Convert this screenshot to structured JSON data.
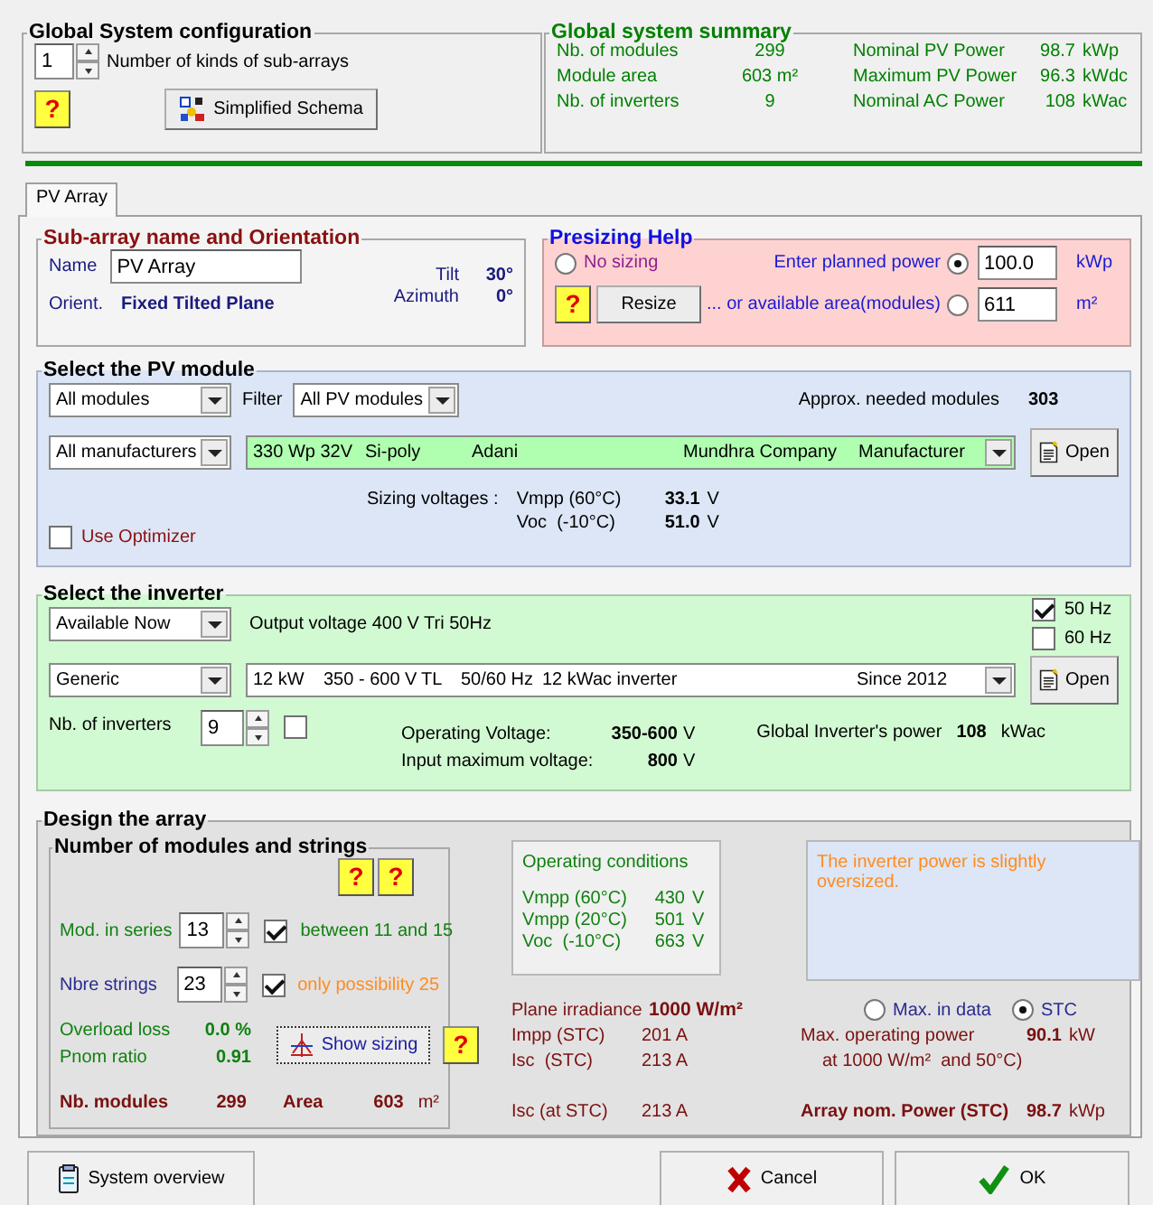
{
  "config": {
    "title": "Global System configuration",
    "kinds_value": "1",
    "kinds_label": "Number of kinds of sub-arrays",
    "help": "?",
    "schema_button": "Simplified Schema"
  },
  "summary": {
    "title": "Global system summary",
    "rows": [
      {
        "label": "Nb. of modules",
        "value": "299",
        "label2": "Nominal PV Power",
        "value2": "98.7",
        "unit2": "kWp"
      },
      {
        "label": "Module area",
        "value": "603 m²",
        "label2": "Maximum PV Power",
        "value2": "96.3",
        "unit2": "kWdc"
      },
      {
        "label": "Nb. of inverters",
        "value": "9",
        "label2": "Nominal AC Power",
        "value2": "108",
        "unit2": "kWac"
      }
    ]
  },
  "tabs": [
    {
      "label": "PV Array",
      "selected": true
    }
  ],
  "orientation": {
    "title": "Sub-array name and Orientation",
    "name_label": "Name",
    "name_value": "PV Array",
    "orient_label": "Orient.",
    "orient_value": "Fixed Tilted Plane",
    "angles": [
      {
        "label": "Tilt",
        "value": "30°"
      },
      {
        "label": "Azimuth",
        "value": "0°"
      }
    ]
  },
  "presizing": {
    "title": "Presizing Help",
    "help": "?",
    "resize_button": "Resize",
    "options": [
      {
        "kind": "plain",
        "label": "No sizing",
        "selected": false
      },
      {
        "kind": "input",
        "label": "Enter planned power",
        "selected": true,
        "value": "100.0",
        "unit": "kWp"
      },
      {
        "kind": "input",
        "label": "... or available area(modules)",
        "selected": false,
        "value": "611",
        "unit": "m²"
      }
    ]
  },
  "module": {
    "title": "Select the PV module",
    "category": "All modules",
    "filter_label": "Filter",
    "filter": "All PV modules",
    "needed_label": "Approx. needed modules",
    "needed_value": "303",
    "manufacturer": "All manufacturers",
    "selection": [
      "330 Wp 32V",
      "Si-poly",
      "Adani",
      "Mundhra Company",
      "Manufacturer"
    ],
    "open_button": "Open",
    "sizing_label": "Sizing voltages :",
    "voltages": [
      {
        "label": "Vmpp (60°C)",
        "value": "33.1",
        "unit": "V"
      },
      {
        "label": "Voc  (-10°C)",
        "value": "51.0",
        "unit": "V"
      }
    ],
    "optimizer": {
      "label": "Use Optimizer",
      "checked": false
    }
  },
  "inverter": {
    "title": "Select the inverter",
    "availability": "Available Now",
    "output_voltage": "Output voltage 400 V Tri 50Hz",
    "frequencies": [
      {
        "label": "50 Hz",
        "checked": true
      },
      {
        "label": "60 Hz",
        "checked": false
      }
    ],
    "manufacturer": "Generic",
    "selection": [
      "12 kW",
      "350 - 600 V",
      "TL",
      "50/60 Hz",
      "12 kWac inverter",
      "Since 2012"
    ],
    "open_button": "Open",
    "count_label": "Nb. of inverters",
    "count_value": "9",
    "count_checked": false,
    "voltages": [
      {
        "label": "Operating Voltage:",
        "value": "350-600",
        "unit": "V"
      },
      {
        "label": "Input maximum voltage:",
        "value": "800",
        "unit": "V"
      }
    ],
    "power_label": "Global Inverter's power",
    "power_value": "108",
    "power_unit": "kWac"
  },
  "design": {
    "title": "Design the array",
    "strings_title": "Number of modules and strings",
    "helps": [
      "?",
      "?"
    ],
    "series": {
      "label": "Mod. in series",
      "value": "13",
      "checked": true,
      "note": "between 11 and 15"
    },
    "strings": {
      "label": "Nbre strings",
      "value": "23",
      "checked": true,
      "note": "only possibility 25"
    },
    "ratios": [
      {
        "label": "Overload loss",
        "value": "0.0 %"
      },
      {
        "label": "Pnom ratio",
        "value": "0.91"
      }
    ],
    "show_button": "Show sizing",
    "show_help": "?",
    "totals": {
      "modules_label": "Nb. modules",
      "modules_value": "299",
      "area_label": "Area",
      "area_value": "603",
      "area_unit": "m²"
    },
    "conditions": {
      "title": "Operating conditions",
      "rows": [
        {
          "label": "Vmpp (60°C)",
          "value": "430",
          "unit": "V"
        },
        {
          "label": "Vmpp (20°C)",
          "value": "501",
          "unit": "V"
        },
        {
          "label": "Voc  (-10°C)",
          "value": "663",
          "unit": "V"
        }
      ]
    },
    "message": "The inverter power is slightly oversized.",
    "irradiance": {
      "label": "Plane irradiance",
      "value": "1000 W/m²"
    },
    "currents": [
      {
        "label": "Impp (STC)",
        "value": "201 A"
      },
      {
        "label": "Isc  (STC)",
        "value": "213 A"
      }
    ],
    "isc_at": {
      "label": "Isc (at STC)",
      "value": "213 A"
    },
    "modes": [
      {
        "label": "Max. in data",
        "selected": false
      },
      {
        "label": "STC",
        "selected": true
      }
    ],
    "max_power": {
      "label": "Max. operating power",
      "value": "90.1",
      "unit": "kW",
      "note": "at 1000 W/m²  and 50°C)"
    },
    "nom_power": {
      "label": "Array nom. Power (STC)",
      "value": "98.7",
      "unit": "kWp"
    }
  },
  "buttons": [
    {
      "kind": "overview",
      "label": "System overview"
    },
    {
      "kind": "cancel",
      "label": "Cancel"
    },
    {
      "kind": "ok",
      "label": "OK"
    }
  ]
}
